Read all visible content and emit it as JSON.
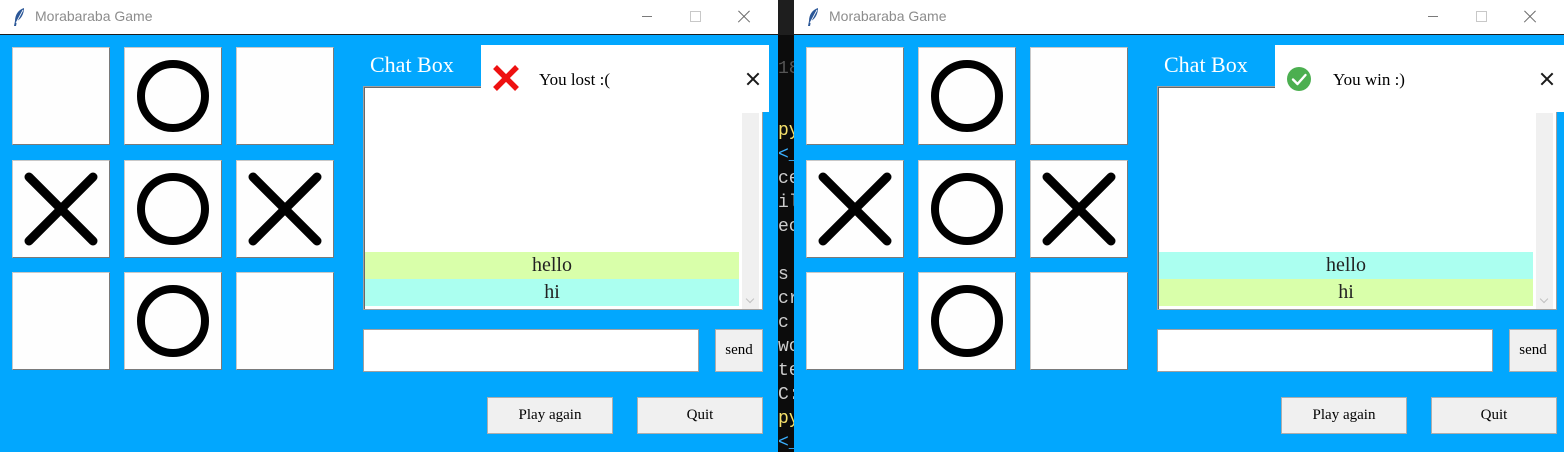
{
  "left_window": {
    "title": "Morabaraba Game",
    "board": [
      "",
      "O",
      "",
      "X",
      "O",
      "X",
      "",
      "O",
      ""
    ],
    "chat_label": "Chat Box",
    "messages": [
      {
        "text": "hello",
        "color": "#d9ffaa"
      },
      {
        "text": "hi",
        "color": "#abfff0"
      }
    ],
    "message_input_value": "",
    "send_label": "send",
    "play_again_label": "Play again",
    "quit_label": "Quit",
    "notification": {
      "text": "You lost :(",
      "icon": "red-x-icon",
      "icon_color": "#ee1111"
    }
  },
  "right_window": {
    "title": "Morabaraba Game",
    "board": [
      "",
      "O",
      "",
      "X",
      "O",
      "X",
      "",
      "O",
      ""
    ],
    "chat_label": "Chat Box",
    "messages": [
      {
        "text": "hello",
        "color": "#abfff0"
      },
      {
        "text": "hi",
        "color": "#d9ffaa"
      }
    ],
    "message_input_value": "",
    "send_label": "send",
    "play_again_label": "Play again",
    "quit_label": "Quit",
    "notification": {
      "text": "You win :)",
      "icon": "green-check-icon",
      "icon_color": "#4caf50"
    }
  },
  "background_terminal": {
    "fragments": [
      "180",
      "py",
      "<_",
      "ce",
      "il",
      "ec",
      " s",
      "cr",
      " c",
      "wo",
      "te",
      "C:",
      "py",
      "<_"
    ]
  },
  "colors": {
    "window_background": "#02a7fe",
    "cell_background": "#fefefe"
  }
}
